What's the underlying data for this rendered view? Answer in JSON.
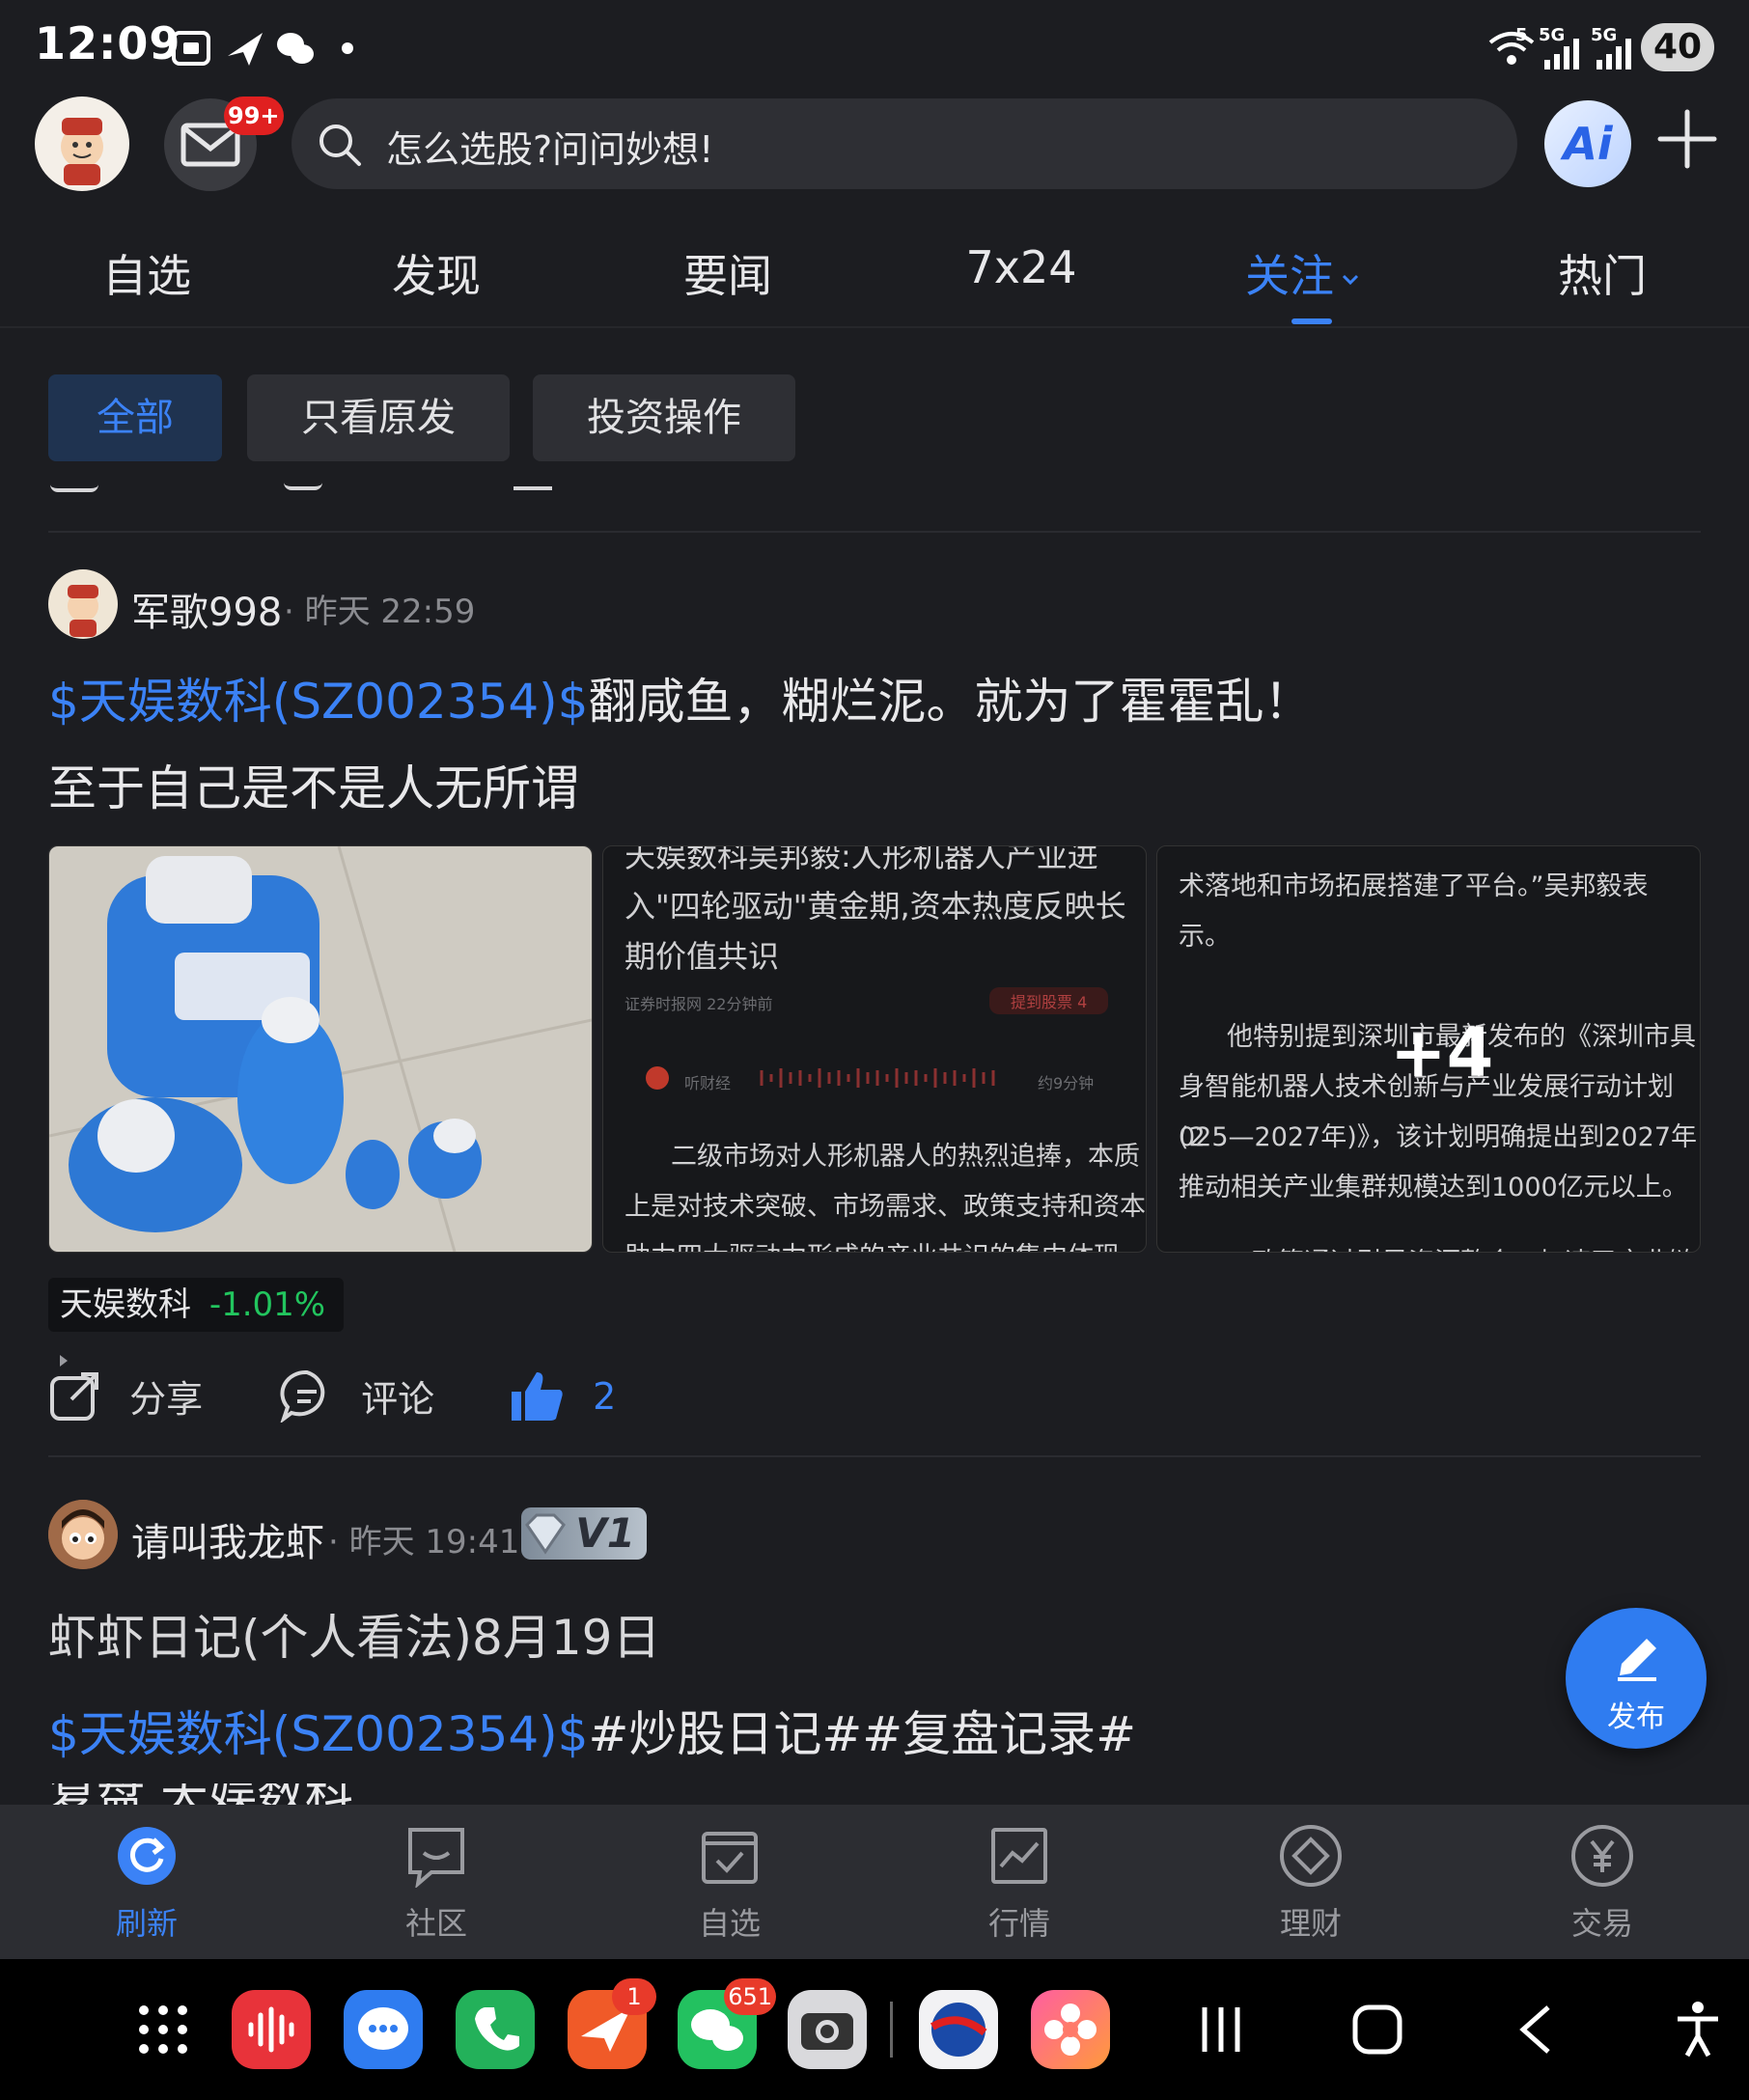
{
  "status_bar": {
    "time": "12:09",
    "battery": "40",
    "net1": "5G",
    "net2": "5G",
    "wifi_sub": "5"
  },
  "header": {
    "mail_badge": "99+",
    "search_placeholder": "怎么选股?问问妙想!",
    "ai_label": "Ai"
  },
  "tabs": [
    {
      "label": "自选"
    },
    {
      "label": "发现"
    },
    {
      "label": "要闻"
    },
    {
      "label": "7x24"
    },
    {
      "label": "关注",
      "active": true
    },
    {
      "label": "热门"
    }
  ],
  "filters": [
    {
      "label": "全部",
      "active": true
    },
    {
      "label": "只看原发"
    },
    {
      "label": "投资操作"
    }
  ],
  "posts": [
    {
      "author": "军歌998",
      "time": "· 昨天 22:59",
      "link_text": "$天娱数科(SZ002354)$",
      "text_after_link": "翻咸鱼，糊烂泥。就为了霍霍乱！",
      "line2": "至于自己是不是人无所谓",
      "thumb2": {
        "lines": [
          "天娱数科吴邦毅:人形机器人产业进",
          "入\"四轮驱动\"黄金期,资本热度反映长",
          "期价值共识"
        ],
        "source": "证券时报网 22分钟前",
        "tag": "提到股票 4",
        "audio_label": "听财经",
        "audio_len": "约9分钟",
        "body": [
          "二级市场对人形机器人的热烈追捧，本质",
          "上是对技术突破、市场需求、政策支持和资本",
          "助力四大驱动力形成的产业共识的集中体现"
        ]
      },
      "thumb3": {
        "lines": [
          "术落地和市场拓展搭建了平台。”吴邦毅表",
          "示。",
          "",
          "他特别提到深圳市最新发布的《深圳市具",
          "身智能机器人技术创新与产业发展行动计划(2",
          "025—2027年)》，该计划明确提出到2027年",
          "推动相关产业集群规模达到1000亿元以上。",
          "",
          "“政策通过引导资源整合，加速了产业链"
        ],
        "more": "+4"
      },
      "stock_tag": {
        "name": "天娱数科",
        "change": "-1.01%"
      },
      "actions": {
        "share": "分享",
        "comment": "评论",
        "likes": "2"
      }
    },
    {
      "author": "请叫我龙虾",
      "time": "· 昨天 19:41",
      "badge": "V1",
      "title": "虾虾日记(个人看法)8月19日",
      "link_text": "$天娱数科(SZ002354)$",
      "text_after_link": "#炒股日记##复盘记录#",
      "partial_line": "复盘 天娱数科"
    }
  ],
  "fab": {
    "label": "发布"
  },
  "bottom_nav": [
    {
      "label": "刷新",
      "icon": "refresh-icon",
      "active": true
    },
    {
      "label": "社区",
      "icon": "chat-icon"
    },
    {
      "label": "自选",
      "icon": "check-list-icon"
    },
    {
      "label": "行情",
      "icon": "chart-icon"
    },
    {
      "label": "理财",
      "icon": "diamond-icon"
    },
    {
      "label": "交易",
      "icon": "yen-icon"
    }
  ],
  "dock": {
    "badge_app5": "1",
    "badge_wechat": "651"
  },
  "colors": {
    "accent": "#3b82f6",
    "down": "#22c55e",
    "bg": "#1c1d21"
  }
}
